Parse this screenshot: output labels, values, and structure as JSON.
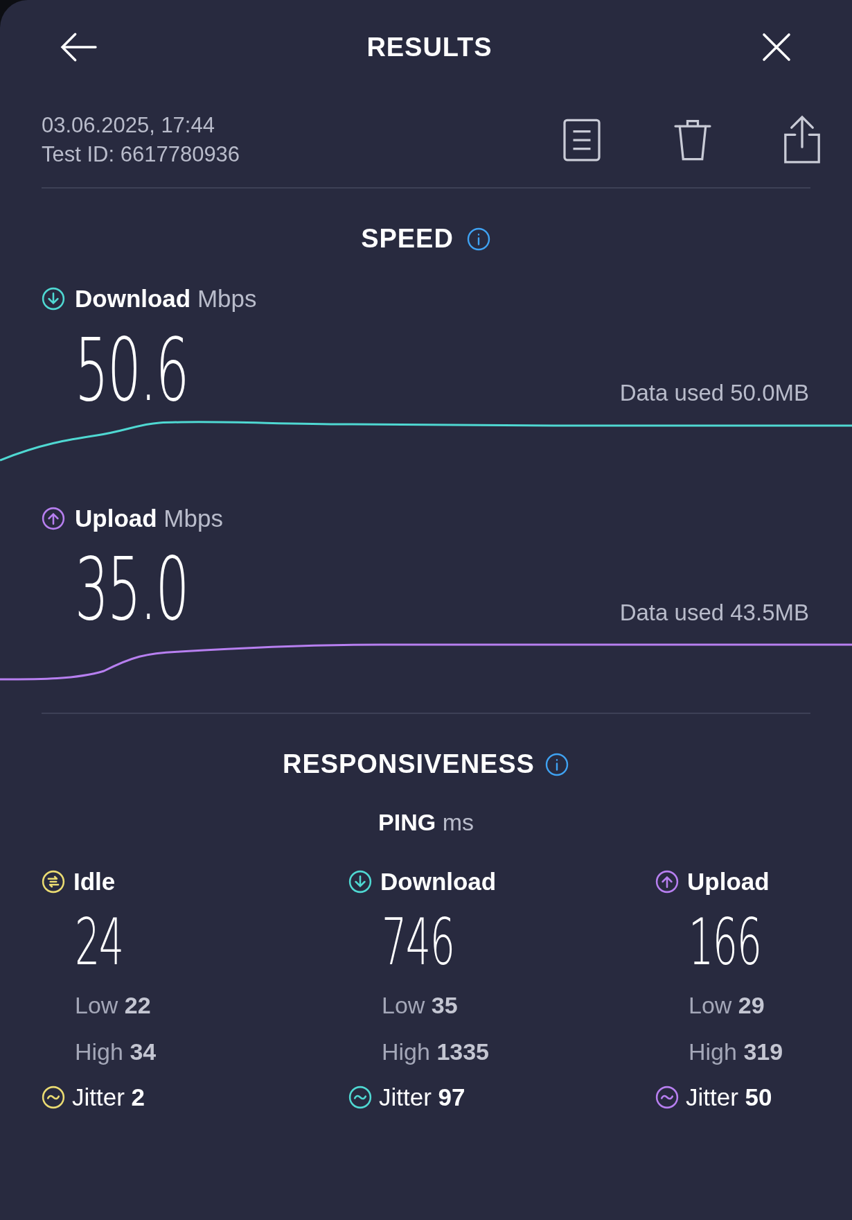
{
  "header": {
    "title": "RESULTS"
  },
  "test": {
    "datetime": "03.06.2025, 17:44",
    "test_id": "Test ID: 6617780936"
  },
  "speed": {
    "title": "SPEED",
    "metrics": [
      {
        "kind": "download",
        "label": "Download",
        "unit": "Mbps",
        "value": "50.6",
        "data_used": "Data used 50.0MB"
      },
      {
        "kind": "upload",
        "label": "Upload",
        "unit": "Mbps",
        "value": "35.0",
        "data_used": "Data used 43.5MB"
      }
    ]
  },
  "responsiveness": {
    "title": "RESPONSIVENESS",
    "ping_label": "PING",
    "ping_unit": "ms",
    "columns": [
      {
        "kind": "idle",
        "label": "Idle",
        "value": "24",
        "low_label": "Low",
        "low": "22",
        "high_label": "High",
        "high": "34",
        "jitter_label": "Jitter",
        "jitter": "2"
      },
      {
        "kind": "download",
        "label": "Download",
        "value": "746",
        "low_label": "Low",
        "low": "35",
        "high_label": "High",
        "high": "1335",
        "jitter_label": "Jitter",
        "jitter": "97"
      },
      {
        "kind": "upload",
        "label": "Upload",
        "value": "166",
        "low_label": "Low",
        "low": "29",
        "high_label": "High",
        "high": "319",
        "jitter_label": "Jitter",
        "jitter": "50"
      }
    ]
  }
}
